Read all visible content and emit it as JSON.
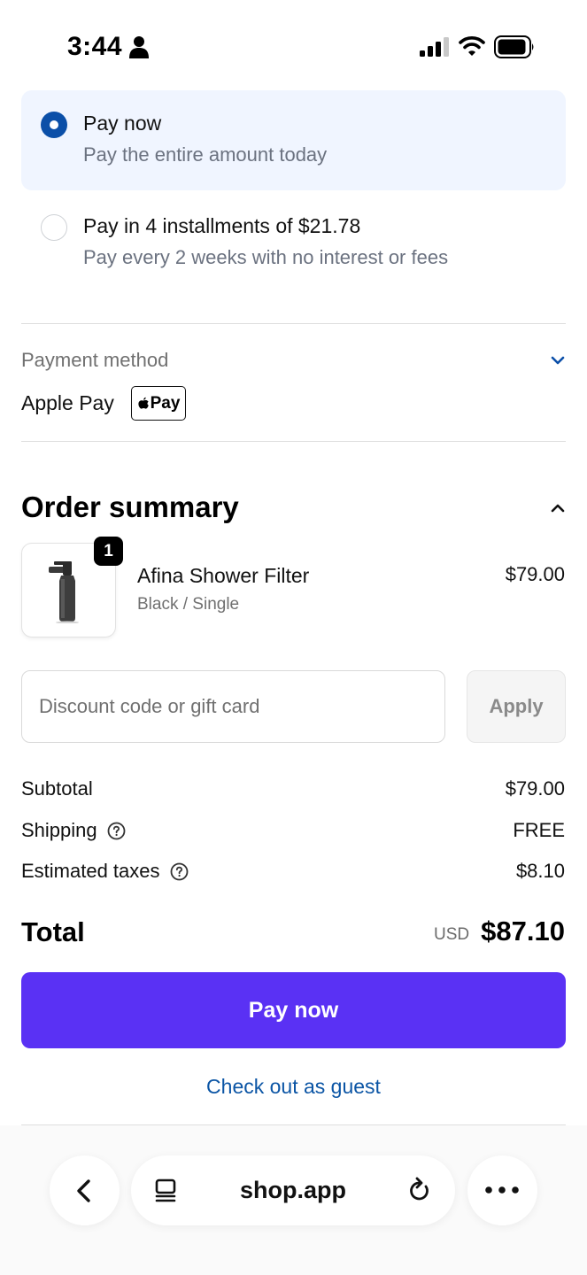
{
  "status_bar": {
    "time": "3:44"
  },
  "payment_options": [
    {
      "title": "Pay now",
      "subtitle": "Pay the entire amount today",
      "selected": true
    },
    {
      "title": "Pay in 4 installments of $21.78",
      "subtitle": "Pay every 2 weeks with no interest or fees",
      "selected": false
    }
  ],
  "payment_method": {
    "label": "Payment method",
    "value": "Apple Pay",
    "badge": "Pay"
  },
  "order_summary": {
    "title": "Order summary",
    "item": {
      "quantity": "1",
      "name": "Afina Shower Filter",
      "variant": "Black / Single",
      "price": "$79.00"
    }
  },
  "discount": {
    "placeholder": "Discount code or gift card",
    "apply_label": "Apply"
  },
  "totals": {
    "subtotal_label": "Subtotal",
    "subtotal_value": "$79.00",
    "shipping_label": "Shipping",
    "shipping_value": "FREE",
    "taxes_label": "Estimated taxes",
    "taxes_value": "$8.10",
    "total_label": "Total",
    "currency": "USD",
    "total_value": "$87.10"
  },
  "pay_button_label": "Pay now",
  "guest_link": "Check out as guest",
  "browser": {
    "url": "shop.app"
  },
  "colors": {
    "accent": "#5a31f4",
    "radio": "#0b4fa8",
    "link": "#0b55a5",
    "selected_bg": "#f0f5ff"
  }
}
